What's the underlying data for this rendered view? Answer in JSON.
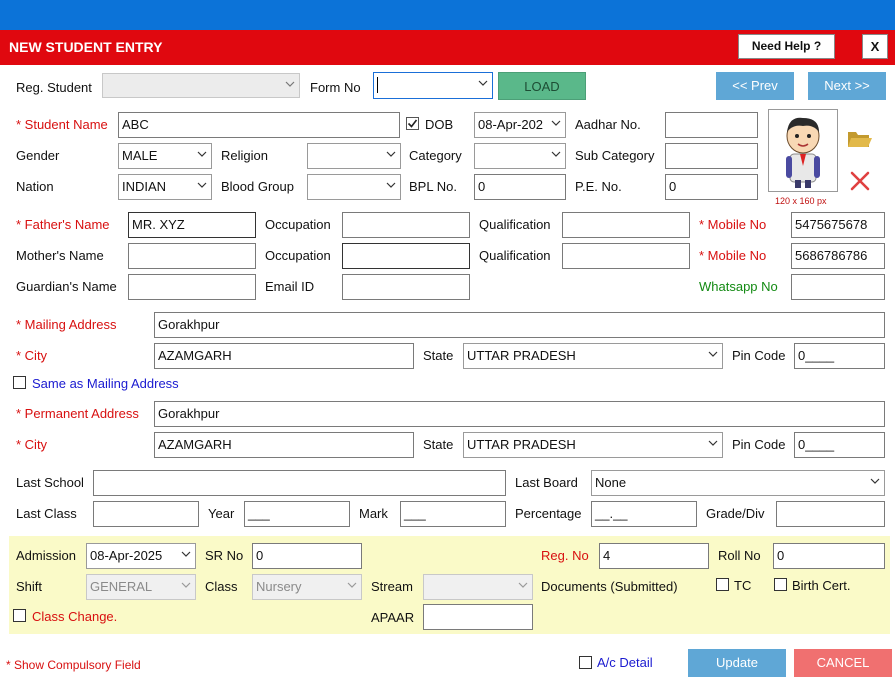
{
  "title": "NEW STUDENT ENTRY",
  "help_label": "Need Help ?",
  "close_label": "X",
  "top": {
    "reg_student_label": "Reg. Student",
    "reg_student_value": "",
    "form_no_label": "Form No",
    "form_no_value": "",
    "load_label": "LOAD",
    "prev_label": "<< Prev",
    "next_label": "Next >>"
  },
  "student": {
    "name_label": "* Student Name",
    "name_value": "ABC",
    "dob_label": "DOB",
    "dob_value": "08-Apr-202",
    "aadhar_label": "Aadhar No.",
    "aadhar_value": "",
    "gender_label": "Gender",
    "gender_value": "MALE",
    "religion_label": "Religion",
    "religion_value": "",
    "category_label": "Category",
    "category_value": "",
    "subcategory_label": "Sub Category",
    "subcategory_value": "",
    "nation_label": "Nation",
    "nation_value": "INDIAN",
    "blood_group_label": "Blood Group",
    "blood_group_value": "",
    "bpl_label": "BPL No.",
    "bpl_value": "0",
    "pe_label": "P.E. No.",
    "pe_value": "0",
    "photo_size": "120 x 160 px"
  },
  "parents": {
    "father_label": "* Father's Name",
    "father_value": "MR. XYZ",
    "occupation_label": "Occupation",
    "father_occupation": "",
    "qualification_label": "Qualification",
    "father_qualification": "",
    "mobile_label": "* Mobile  No",
    "father_mobile": "5475675678",
    "mother_label": "Mother's Name",
    "mother_value": "",
    "mother_occupation": "",
    "mother_qualification": "",
    "mobile2_label": "* Mobile No",
    "mother_mobile": "5686786786",
    "guardian_label": "Guardian's Name",
    "guardian_value": "",
    "email_label": "Email ID",
    "email_value": "",
    "whatsapp_label": "Whatsapp No",
    "whatsapp_value": ""
  },
  "address": {
    "mailing_label": "* Mailing Address",
    "mailing_value": "Gorakhpur",
    "city_label": "* City",
    "mailing_city": "AZAMGARH",
    "state_label": "State",
    "mailing_state": "UTTAR PRADESH",
    "pin_label": "Pin Code",
    "mailing_pin": "0____",
    "same_label": "Same as Mailing Address",
    "permanent_label": "* Permanent Address",
    "permanent_value": "Gorakhpur",
    "permanent_city": "AZAMGARH",
    "permanent_state": "UTTAR PRADESH",
    "permanent_pin": "0____"
  },
  "school": {
    "last_school_label": "Last School",
    "last_school_value": "",
    "last_board_label": "Last Board",
    "last_board_value": "None",
    "last_class_label": "Last Class",
    "last_class_value": "",
    "year_label": "Year",
    "year_value": "___",
    "mark_label": "Mark",
    "mark_value": "___",
    "percentage_label": "Percentage",
    "percentage_value": "__.__",
    "grade_label": "Grade/Div",
    "grade_value": ""
  },
  "admission": {
    "admission_label": "Admission",
    "admission_value": "08-Apr-2025",
    "sr_label": "SR No",
    "sr_value": "0",
    "reg_label": "Reg. No",
    "reg_value": "4",
    "roll_label": "Roll No",
    "roll_value": "0",
    "shift_label": "Shift",
    "shift_value": "GENERAL",
    "class_label": "Class",
    "class_value": "Nursery",
    "stream_label": "Stream",
    "stream_value": "",
    "documents_label": "Documents (Submitted)",
    "tc_label": "TC",
    "birth_label": "Birth Cert.",
    "class_change_label": "Class Change.",
    "apaar_label": "APAAR",
    "apaar_value": ""
  },
  "footer": {
    "compulsory_label": "* Show Compulsory Field",
    "ac_detail_label": "A/c Detail",
    "update_label": "Update",
    "cancel_label": "CANCEL"
  },
  "colors": {
    "header_red": "#e0080f",
    "top_blue": "#0c73d8",
    "load_green": "#5ab88a",
    "nav_blue": "#5fa7d6",
    "cancel_pink": "#f07070",
    "panel_yellow": "#fafac8"
  }
}
